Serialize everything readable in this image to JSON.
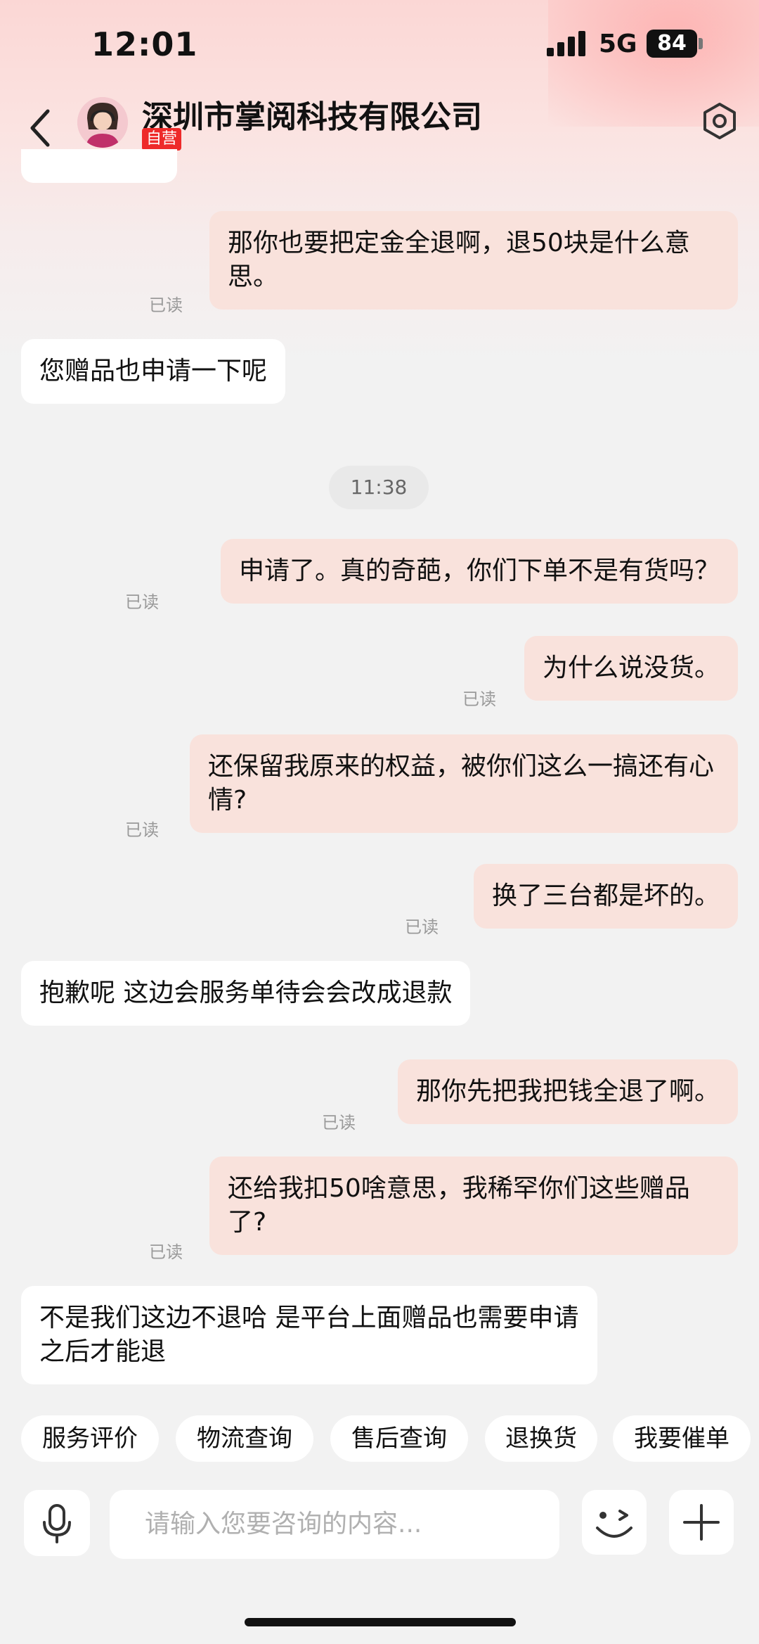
{
  "status": {
    "time": "12:01",
    "network": "5G",
    "battery": "84"
  },
  "header": {
    "title": "深圳市掌阅科技有限公司",
    "badge": "自营"
  },
  "messages": [
    {
      "side": "out",
      "text": "那你也要把定金全退啊，退50块是什么意思。",
      "read": "已读"
    },
    {
      "side": "in",
      "text": "您赠品也申请一下呢"
    },
    {
      "side": "out",
      "text": "申请了。真的奇葩，你们下单不是有货吗？",
      "read": "已读"
    },
    {
      "side": "out",
      "text": "为什么说没货。",
      "read": "已读"
    },
    {
      "side": "out",
      "text": "还保留我原来的权益，被你们这么一搞还有心情?",
      "read": "已读"
    },
    {
      "side": "out",
      "text": "换了三台都是坏的。",
      "read": "已读"
    },
    {
      "side": "in",
      "text": "抱歉呢 这边会服务单待会会改成退款"
    },
    {
      "side": "out",
      "text": "那你先把我把钱全退了啊。",
      "read": "已读"
    },
    {
      "side": "out",
      "text": "还给我扣50啥意思，我稀罕你们这些赠品了?",
      "read": "已读"
    },
    {
      "side": "in",
      "text": "不是我们这边不退哈 是平台上面赠品也需要申请之后才能退"
    }
  ],
  "time_divider": "11:38",
  "quick_replies": [
    "服务评价",
    "物流查询",
    "售后查询",
    "退换货",
    "我要催单"
  ],
  "input": {
    "placeholder": "请输入您要咨询的内容..."
  },
  "icons": {
    "back": "chevron-left-icon",
    "settings": "hexagon-settings-icon",
    "mic": "microphone-icon",
    "emoji": "wink-emoji-icon",
    "plus": "plus-icon"
  }
}
